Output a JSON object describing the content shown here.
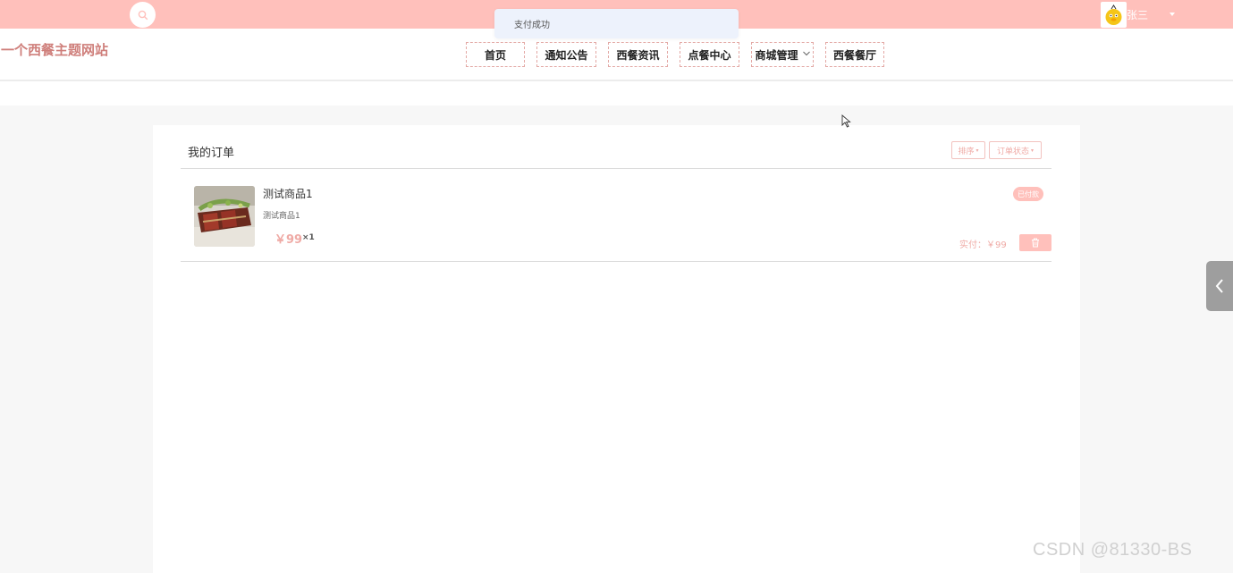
{
  "toast": {
    "message": "支付成功"
  },
  "user": {
    "name": "张三"
  },
  "site": {
    "title": "一个西餐主题网站"
  },
  "nav": {
    "items": [
      {
        "label": "首页"
      },
      {
        "label": "通知公告"
      },
      {
        "label": "西餐资讯"
      },
      {
        "label": "点餐中心"
      },
      {
        "label": "商城管理",
        "has_dropdown": true
      },
      {
        "label": "西餐餐厅"
      }
    ]
  },
  "orders": {
    "title": "我的订单",
    "sort_label": "排序",
    "status_filter_label": "订单状态",
    "items": [
      {
        "name": "测试商品1",
        "subtitle": "测试商品1",
        "price": "￥99",
        "quantity": "×1",
        "status": "已付款",
        "paid_label": "实付：￥99"
      }
    ]
  },
  "icons": {
    "search": "search-icon",
    "avatar": "avatar-icon",
    "user_menu": "chevron-down-icon",
    "delete": "trash-icon",
    "side_tab": "chevron-left-icon"
  },
  "colors": {
    "accent": "#ffc0bb",
    "accent_text": "#efaaa5",
    "site_title": "#cf7f7b",
    "toast_bg": "#edf2fc"
  },
  "watermark": "CSDN @81330-BS"
}
